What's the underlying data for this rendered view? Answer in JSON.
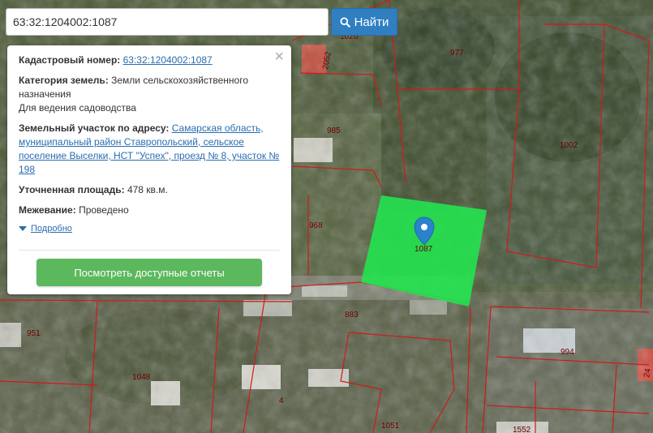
{
  "search": {
    "value": "63:32:1204002:1087",
    "button_label": "Найти"
  },
  "panel": {
    "cadastral_label": "Кадастровый номер:",
    "cadastral_value": "63:32:1204002:1087",
    "category_label": "Категория земель:",
    "category_value": "Земли сельскохозяйственного назначения",
    "usage_value": "Для ведения садоводства",
    "address_label": "Земельный участок по адресу:",
    "address_value": "Самарская область, муниципальный район Ставропольский, сельское поселение Выселки, НСТ \"Успех\", проезд № 8, участок № 198",
    "area_label": "Уточненная площадь:",
    "area_value": "478 кв.м.",
    "survey_label": "Межевание:",
    "survey_value": "Проведено",
    "more_label": "Подробно",
    "report_button": "Посмотреть доступные отчеты"
  },
  "map": {
    "plot_labels": [
      "1020",
      "2052",
      "977",
      "985",
      "1002",
      "968",
      "1087",
      "883",
      "951",
      "1048",
      "994",
      "4",
      "1051",
      "1552",
      "24"
    ],
    "selected_color": "#22e34f",
    "boundary_color": "#d11a1a"
  }
}
